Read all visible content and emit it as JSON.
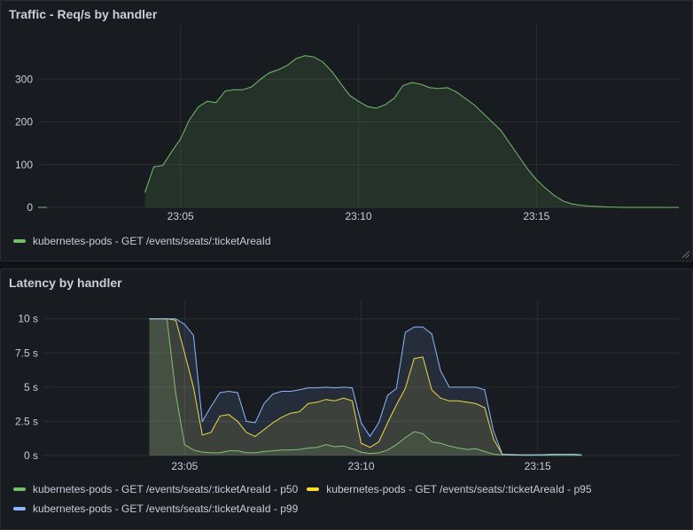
{
  "panels": {
    "traffic": {
      "title": "Traffic - Req/s by handler",
      "legend": [
        {
          "label": "kubernetes-pods - GET /events/seats/:ticketAreaId",
          "color": "#73bf69"
        }
      ]
    },
    "latency": {
      "title": "Latency by handler",
      "legend": [
        {
          "label": "kubernetes-pods - GET /events/seats/:ticketAreaId - p50",
          "color": "#73bf69"
        },
        {
          "label": "kubernetes-pods - GET /events/seats/:ticketAreaId - p95",
          "color": "#fade2a"
        },
        {
          "label": "kubernetes-pods - GET /events/seats/:ticketAreaId - p99",
          "color": "#8ab8ff"
        }
      ]
    }
  },
  "chart_data": [
    {
      "type": "area",
      "title": "Traffic - Req/s by handler",
      "xlabel": "",
      "ylabel": "",
      "xticks": [
        "23:05",
        "23:10",
        "23:15"
      ],
      "yticks": [
        "0",
        "100",
        "200",
        "300"
      ],
      "xlim": [
        "23:01",
        "23:19"
      ],
      "ylim": [
        0,
        400
      ],
      "grid": true,
      "legend_position": "bottom",
      "series": [
        {
          "name": "kubernetes-pods - GET /events/seats/:ticketAreaId",
          "color": "#73bf69",
          "x": [
            "23:01:00",
            "23:01:15",
            "23:04:00",
            "23:04:15",
            "23:04:30",
            "23:04:45",
            "23:05:00",
            "23:05:15",
            "23:05:30",
            "23:05:45",
            "23:06:00",
            "23:06:15",
            "23:06:30",
            "23:06:45",
            "23:07:00",
            "23:07:15",
            "23:07:30",
            "23:07:45",
            "23:08:00",
            "23:08:15",
            "23:08:30",
            "23:08:45",
            "23:09:00",
            "23:09:15",
            "23:09:30",
            "23:09:45",
            "23:10:00",
            "23:10:15",
            "23:10:30",
            "23:10:45",
            "23:11:00",
            "23:11:15",
            "23:11:30",
            "23:11:45",
            "23:12:00",
            "23:12:15",
            "23:12:30",
            "23:12:45",
            "23:13:00",
            "23:13:15",
            "23:13:30",
            "23:13:45",
            "23:14:00",
            "23:14:15",
            "23:14:30",
            "23:14:45",
            "23:15:00",
            "23:15:15",
            "23:15:30",
            "23:15:45",
            "23:16:00",
            "23:16:15",
            "23:16:30",
            "23:16:45",
            "23:17:00",
            "23:17:30",
            "23:18:00",
            "23:18:30",
            "23:19:00"
          ],
          "values": [
            0,
            0,
            35,
            95,
            98,
            130,
            160,
            205,
            235,
            248,
            245,
            272,
            275,
            275,
            282,
            300,
            315,
            322,
            332,
            348,
            355,
            352,
            340,
            318,
            290,
            262,
            248,
            236,
            232,
            240,
            255,
            285,
            292,
            288,
            280,
            278,
            280,
            270,
            255,
            240,
            220,
            200,
            180,
            150,
            120,
            90,
            65,
            45,
            28,
            15,
            8,
            5,
            3,
            2,
            1,
            0,
            0,
            0,
            0
          ]
        }
      ]
    },
    {
      "type": "area",
      "title": "Latency by handler",
      "xlabel": "",
      "ylabel": "",
      "xticks": [
        "23:05",
        "23:10",
        "23:15"
      ],
      "yticks": [
        "0 s",
        "2.5 s",
        "5 s",
        "7.5 s",
        "10 s"
      ],
      "xlim": [
        "23:01",
        "23:19"
      ],
      "ylim": [
        0,
        10.5
      ],
      "grid": true,
      "legend_position": "bottom",
      "series": [
        {
          "name": "kubernetes-pods - GET /events/seats/:ticketAreaId - p50",
          "color": "#73bf69",
          "x": [
            "23:04:00",
            "23:04:15",
            "23:04:30",
            "23:04:45",
            "23:05:00",
            "23:05:15",
            "23:05:30",
            "23:05:45",
            "23:06:00",
            "23:06:15",
            "23:06:30",
            "23:06:45",
            "23:07:00",
            "23:07:15",
            "23:07:30",
            "23:07:45",
            "23:08:00",
            "23:08:15",
            "23:08:30",
            "23:08:45",
            "23:09:00",
            "23:09:15",
            "23:09:30",
            "23:09:45",
            "23:10:00",
            "23:10:15",
            "23:10:30",
            "23:10:45",
            "23:11:00",
            "23:11:15",
            "23:11:30",
            "23:11:45",
            "23:12:00",
            "23:12:15",
            "23:12:30",
            "23:12:45",
            "23:13:00",
            "23:13:15",
            "23:13:30",
            "23:13:45",
            "23:14:00",
            "23:14:15",
            "23:14:30",
            "23:14:45",
            "23:15:00",
            "23:15:30",
            "23:16:00",
            "23:16:15"
          ],
          "values": [
            10,
            10,
            10,
            4.5,
            0.8,
            0.4,
            0.25,
            0.2,
            0.2,
            0.35,
            0.35,
            0.2,
            0.2,
            0.3,
            0.35,
            0.4,
            0.4,
            0.45,
            0.55,
            0.6,
            0.8,
            0.65,
            0.7,
            0.5,
            0.25,
            0.15,
            0.2,
            0.4,
            0.8,
            1.3,
            1.75,
            1.6,
            1.0,
            0.9,
            0.7,
            0.55,
            0.45,
            0.5,
            0.3,
            0.1,
            0.05,
            0.03,
            0.02,
            0.02,
            0.02,
            0.02,
            0.02,
            0.02
          ]
        },
        {
          "name": "kubernetes-pods - GET /events/seats/:ticketAreaId - p95",
          "color": "#fade2a",
          "x": [
            "23:04:00",
            "23:04:15",
            "23:04:30",
            "23:04:45",
            "23:05:00",
            "23:05:15",
            "23:05:30",
            "23:05:45",
            "23:06:00",
            "23:06:15",
            "23:06:30",
            "23:06:45",
            "23:07:00",
            "23:07:15",
            "23:07:30",
            "23:07:45",
            "23:08:00",
            "23:08:15",
            "23:08:30",
            "23:08:45",
            "23:09:00",
            "23:09:15",
            "23:09:30",
            "23:09:45",
            "23:10:00",
            "23:10:15",
            "23:10:30",
            "23:10:45",
            "23:11:00",
            "23:11:15",
            "23:11:30",
            "23:11:45",
            "23:12:00",
            "23:12:15",
            "23:12:30",
            "23:12:45",
            "23:13:00",
            "23:13:15",
            "23:13:30",
            "23:13:45",
            "23:14:00",
            "23:14:15",
            "23:14:30",
            "23:14:45",
            "23:15:00",
            "23:15:30",
            "23:16:00",
            "23:16:15"
          ],
          "values": [
            10,
            10,
            10,
            9.9,
            7.5,
            5.0,
            1.5,
            1.7,
            2.9,
            3.0,
            2.5,
            1.7,
            1.4,
            1.9,
            2.4,
            2.8,
            3.1,
            3.2,
            3.8,
            3.9,
            4.1,
            4.0,
            4.2,
            4.0,
            0.9,
            0.6,
            1.0,
            2.4,
            3.7,
            4.9,
            7.1,
            7.2,
            4.8,
            4.2,
            4.0,
            4.0,
            3.9,
            3.8,
            3.5,
            1.2,
            0.1,
            0.05,
            0.05,
            0.05,
            0.05,
            0.1,
            0.1,
            0.05
          ]
        },
        {
          "name": "kubernetes-pods - GET /events/seats/:ticketAreaId - p99",
          "color": "#8ab8ff",
          "x": [
            "23:04:00",
            "23:04:15",
            "23:04:30",
            "23:04:45",
            "23:05:00",
            "23:05:15",
            "23:05:30",
            "23:05:45",
            "23:06:00",
            "23:06:15",
            "23:06:30",
            "23:06:45",
            "23:07:00",
            "23:07:15",
            "23:07:30",
            "23:07:45",
            "23:08:00",
            "23:08:15",
            "23:08:30",
            "23:08:45",
            "23:09:00",
            "23:09:15",
            "23:09:30",
            "23:09:45",
            "23:10:00",
            "23:10:15",
            "23:10:30",
            "23:10:45",
            "23:11:00",
            "23:11:15",
            "23:11:30",
            "23:11:45",
            "23:12:00",
            "23:12:15",
            "23:12:30",
            "23:12:45",
            "23:13:00",
            "23:13:15",
            "23:13:30",
            "23:13:45",
            "23:14:00",
            "23:14:15",
            "23:14:30",
            "23:14:45",
            "23:15:00",
            "23:15:30",
            "23:16:00",
            "23:16:15"
          ],
          "values": [
            10,
            10,
            10,
            10,
            9.6,
            8.8,
            2.5,
            3.6,
            4.6,
            4.7,
            4.6,
            2.5,
            2.4,
            3.8,
            4.5,
            4.7,
            4.7,
            4.8,
            4.95,
            4.95,
            5.0,
            4.95,
            5.0,
            4.95,
            2.4,
            1.4,
            2.4,
            4.4,
            4.9,
            9.0,
            9.4,
            9.4,
            8.9,
            6.2,
            5.0,
            5.0,
            5.0,
            5.0,
            4.8,
            1.8,
            0.1,
            0.08,
            0.06,
            0.05,
            0.05,
            0.1,
            0.1,
            0.05
          ]
        }
      ]
    }
  ]
}
